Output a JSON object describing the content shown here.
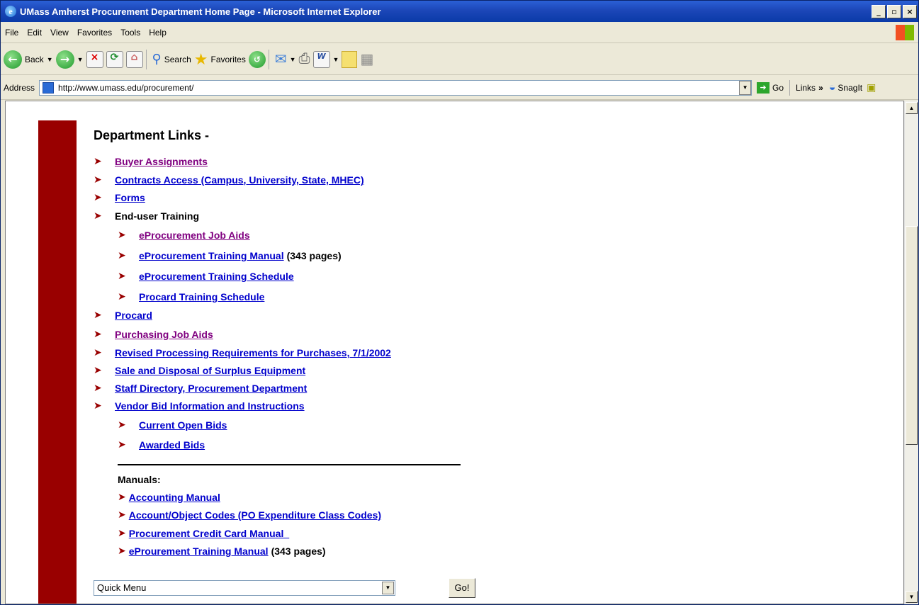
{
  "window": {
    "title": "UMass Amherst Procurement Department Home Page - Microsoft Internet Explorer",
    "min": "_",
    "max": "▫",
    "close": "×"
  },
  "menu": [
    "File",
    "Edit",
    "View",
    "Favorites",
    "Tools",
    "Help"
  ],
  "toolbar": {
    "back": "Back",
    "search": "Search",
    "favorites": "Favorites"
  },
  "address": {
    "label": "Address",
    "url": "http://www.umass.edu/procurement/",
    "go": "Go",
    "links": "Links",
    "more": "»",
    "snagit": "SnagIt"
  },
  "page": {
    "heading": "Department Links -",
    "arrow": "➤",
    "links": [
      {
        "text": "Buyer Assignments",
        "visited": true
      },
      {
        "text": "Contracts Access (Campus, University, State, MHEC)"
      },
      {
        "text": "Forms"
      },
      {
        "text": "End-user Training",
        "plain": true
      },
      {
        "text": "eProcurement Job Aids",
        "visited": true,
        "sub": true
      },
      {
        "text": "eProcurement Training Manual",
        "note": "(343 pages)",
        "sub": true
      },
      {
        "text": "eProcurement Training Schedule",
        "sub": true
      },
      {
        "text": "Procard Training Schedule",
        "sub": true
      },
      {
        "text": "Procard"
      },
      {
        "text": "Purchasing Job Aids",
        "visited": true
      },
      {
        "text": "Revised Processing Requirements for Purchases, 7/1/2002"
      },
      {
        "text": "Sale and Disposal of Surplus Equipment"
      },
      {
        "text": "Staff Directory, Procurement Department"
      },
      {
        "text": "Vendor Bid Information and Instructions"
      },
      {
        "text": "Current Open Bids",
        "sub": true
      },
      {
        "text": "Awarded Bids",
        "sub": true
      }
    ],
    "manuals_heading": "Manuals:",
    "manuals": [
      {
        "text": "Accounting Manual"
      },
      {
        "text": "Account/Object Codes (PO Expenditure Class Codes)"
      },
      {
        "text": "Procurement Credit Card Manual_"
      },
      {
        "text": "eProurement Training Manual",
        "note": "(343 pages)"
      }
    ],
    "quick_menu": "Quick Menu",
    "go_button": "Go!"
  }
}
